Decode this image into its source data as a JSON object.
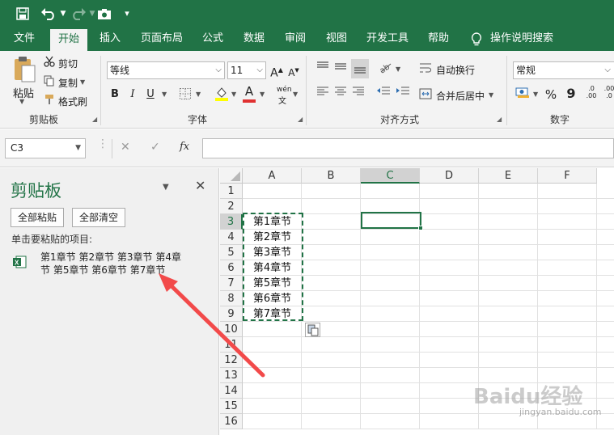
{
  "quick_access": {
    "save": "💾",
    "undo": "↶",
    "redo": "↷",
    "camera": "📷",
    "customize": "▾"
  },
  "tabs": [
    {
      "label": "文件",
      "active": false
    },
    {
      "label": "开始",
      "active": true
    },
    {
      "label": "插入",
      "active": false
    },
    {
      "label": "页面布局",
      "active": false
    },
    {
      "label": "公式",
      "active": false
    },
    {
      "label": "数据",
      "active": false
    },
    {
      "label": "审阅",
      "active": false
    },
    {
      "label": "视图",
      "active": false
    },
    {
      "label": "开发工具",
      "active": false
    },
    {
      "label": "帮助",
      "active": false
    }
  ],
  "tell_me": "操作说明搜索",
  "ribbon": {
    "clipboard": {
      "paste": "粘贴",
      "cut": "剪切",
      "copy": "复制",
      "format_painter": "格式刷",
      "group": "剪贴板"
    },
    "font": {
      "name": "等线",
      "size": "11",
      "grow": "A",
      "shrink": "A",
      "bold": "B",
      "italic": "I",
      "underline": "U",
      "font_color_letter": "A",
      "phonetic": "wén",
      "group": "字体"
    },
    "alignment": {
      "wrap": "自动换行",
      "merge": "合并后居中",
      "group": "对齐方式"
    },
    "number": {
      "format": "常规",
      "percent": "%",
      "comma": "9",
      "inc": ".0\n.00",
      "dec": ".00\n.0",
      "group": "数字"
    }
  },
  "formula_bar": {
    "name_box": "C3",
    "cancel": "✕",
    "enter": "✓",
    "fx": "fx",
    "value": ""
  },
  "clipboard_pane": {
    "title": "剪贴板",
    "paste_all": "全部粘贴",
    "clear_all": "全部清空",
    "instruction": "单击要粘贴的项目:",
    "item_line1": "第1章节 第2章节 第3章节 第4章",
    "item_line2": "节 第5章节 第6章节 第7章节"
  },
  "grid": {
    "columns": [
      "A",
      "B",
      "C",
      "D",
      "E",
      "F"
    ],
    "selected_column": "C",
    "rows": [
      "1",
      "2",
      "3",
      "4",
      "5",
      "6",
      "7",
      "8",
      "9",
      "10",
      "11",
      "12",
      "13",
      "14",
      "15",
      "16"
    ],
    "selected_row": "3",
    "cells": [
      {
        "row": 3,
        "col": "A",
        "value": "第1章节"
      },
      {
        "row": 4,
        "col": "A",
        "value": "第2章节"
      },
      {
        "row": 5,
        "col": "A",
        "value": "第3章节"
      },
      {
        "row": 6,
        "col": "A",
        "value": "第4章节"
      },
      {
        "row": 7,
        "col": "A",
        "value": "第5章节"
      },
      {
        "row": 8,
        "col": "A",
        "value": "第6章节"
      },
      {
        "row": 9,
        "col": "A",
        "value": "第7章节"
      }
    ]
  },
  "watermark": {
    "brand": "Baidu经验",
    "url": "jingyan.baidu.com"
  },
  "colors": {
    "brand": "#217346",
    "marching_ants": "#217346",
    "arrow": "#f24a4a"
  }
}
